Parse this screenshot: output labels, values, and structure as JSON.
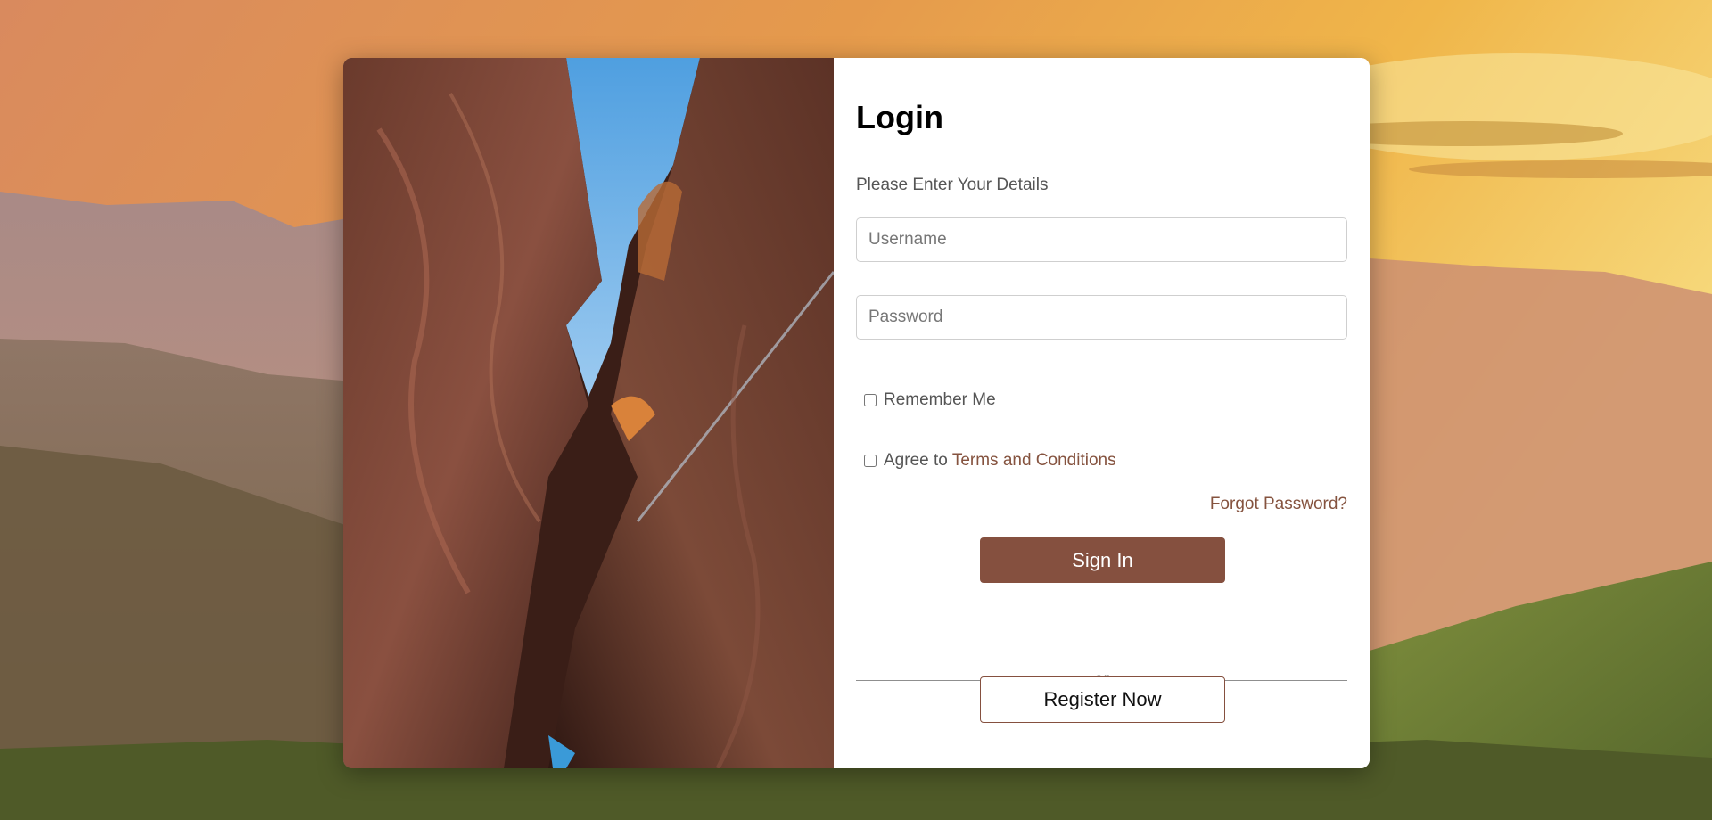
{
  "login": {
    "title": "Login",
    "subtitle": "Please Enter Your Details",
    "username_placeholder": "Username",
    "password_placeholder": "Password",
    "remember_label": "Remember Me",
    "terms_prefix": "Agree to",
    "terms_link": "Terms and Conditions",
    "forgot_link": "Forgot Password?",
    "signin_label": "Sign In",
    "divider_text": "or",
    "register_label": "Register Now"
  },
  "colors": {
    "accent": "#85503f",
    "link": "#85533f",
    "panel": "#ffffff",
    "muted_text": "#555555"
  },
  "images": {
    "background": "mountain-sunset-landscape",
    "card_image": "slot-canyon-photo"
  }
}
